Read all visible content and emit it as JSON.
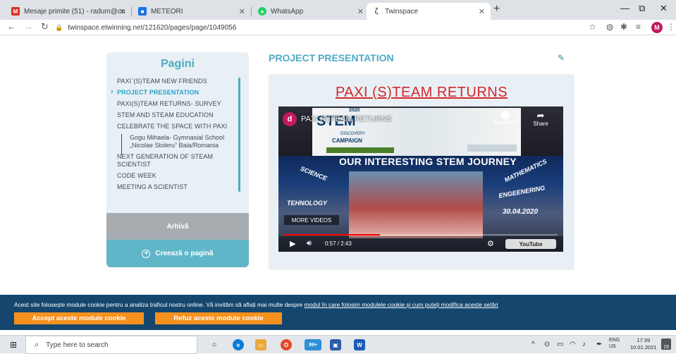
{
  "browser": {
    "tabs": [
      {
        "label": "Mesaje primite (51) - radum@co",
        "favicon": "M"
      },
      {
        "label": "METEORI",
        "favicon": "■"
      },
      {
        "label": "WhatsApp",
        "favicon": "●"
      },
      {
        "label": "Twinspace",
        "favicon": "ζ"
      }
    ],
    "new_tab": "+",
    "url": "twinspace.etwinning.net/121620/pages/page/1049056",
    "profile_initial": "M",
    "window_controls": {
      "minimize": "—",
      "restore": "⧉",
      "close": "✕"
    },
    "accent_colors": {
      "gmail": "#d93025",
      "meteori": "#1a73e8",
      "whatsapp": "#25d366",
      "profile": "#c2185b"
    }
  },
  "sidebar": {
    "title": "Pagini",
    "items": [
      {
        "label": "PAXI`(S)TEAM NEW FRIENDS",
        "active": false
      },
      {
        "label": "PROJECT PRESENTATION",
        "active": true
      },
      {
        "label": "PAXI(S)TEAM RETURNS- SURVEY",
        "active": false
      },
      {
        "label": "STEM AND STEAM EDUCATION",
        "active": false
      },
      {
        "label": "CELEBRATE THE SPACE WITH PAXI",
        "active": false
      }
    ],
    "sub_item": "Gogu Mihaela- Gymnasial School „Nicolae Stoleru” Baia/Romania",
    "items_after": [
      {
        "label": "NEXT GENERATION OF STEAM SCIENTIST"
      },
      {
        "label": "CODE WEEK"
      },
      {
        "label": "MEETING A SCIENTIST"
      }
    ],
    "archive_label": "Arhivă",
    "create_label": "Creează o pagină",
    "accent": "#4fa9c5"
  },
  "main": {
    "page_title": "PROJECT PRESENTATION",
    "article_title": "PAXI (S)TEAM RETURNS",
    "title_color": "#d3282b",
    "video": {
      "channel_initial": "d",
      "title": "PAXI (S)TEAM RETURNS",
      "poster_stem": "STEM",
      "poster_year": "2020",
      "poster_discovery": "DISCOVERY",
      "poster_campaign": "CAMPAIGN",
      "watch_later": "Watch later",
      "share": "Share",
      "headline": "OUR INTERESTING STEM JOURNEY",
      "tags": [
        "SCIENCE",
        "TEHNOLOGY",
        "MATHEMATICS",
        "ENGEENERING"
      ],
      "date": "30.04.2020",
      "more_videos": "MORE VIDEOS",
      "current_time": "0:57",
      "duration": "2:43",
      "progress": 0.35,
      "logo": "YouTube"
    }
  },
  "cookie_banner": {
    "text": "Acest site folosește module cookie pentru a analiza traficul nostru online. Vă invităm să aflați mai multe despre ",
    "link": "modul în care folosim modulele cookie și cum puteți modifica aceste setări",
    "accept": "Accept aceste module cookie",
    "refuse": "Refuz aceste module cookie",
    "bg_color": "#15476e",
    "button_color": "#f6911e"
  },
  "taskbar": {
    "search_placeholder": "Type here to search",
    "store_badge": "99+",
    "lang_top": "ENG",
    "lang_bottom": "US",
    "time": "17:39",
    "date": "10.01.2021",
    "notification_count": "19"
  }
}
